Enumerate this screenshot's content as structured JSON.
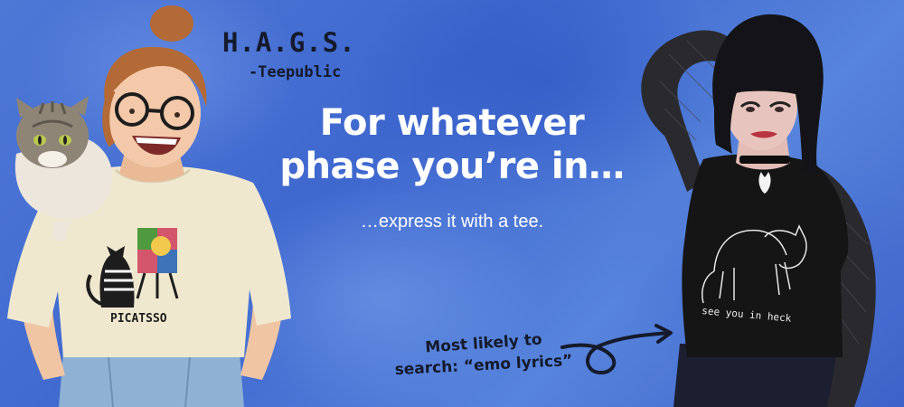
{
  "brand": {
    "title": "H.A.G.S.",
    "subtitle": "-Teepublic"
  },
  "hero": {
    "headline_line1": "For whatever",
    "headline_line2": "phase you’re in…",
    "subline": "…express it with a tee."
  },
  "left_model": {
    "shirt_text": "PICATSSO"
  },
  "right_model": {
    "shirt_text": "see you in heck",
    "note_line1": "Most likely to",
    "note_line2": "search: “emo lyrics”"
  },
  "colors": {
    "background": "#4a73d4",
    "headline": "#ffffff",
    "ink": "#151a2c",
    "left_tee": "#efe8cf",
    "right_tee": "#151515"
  }
}
